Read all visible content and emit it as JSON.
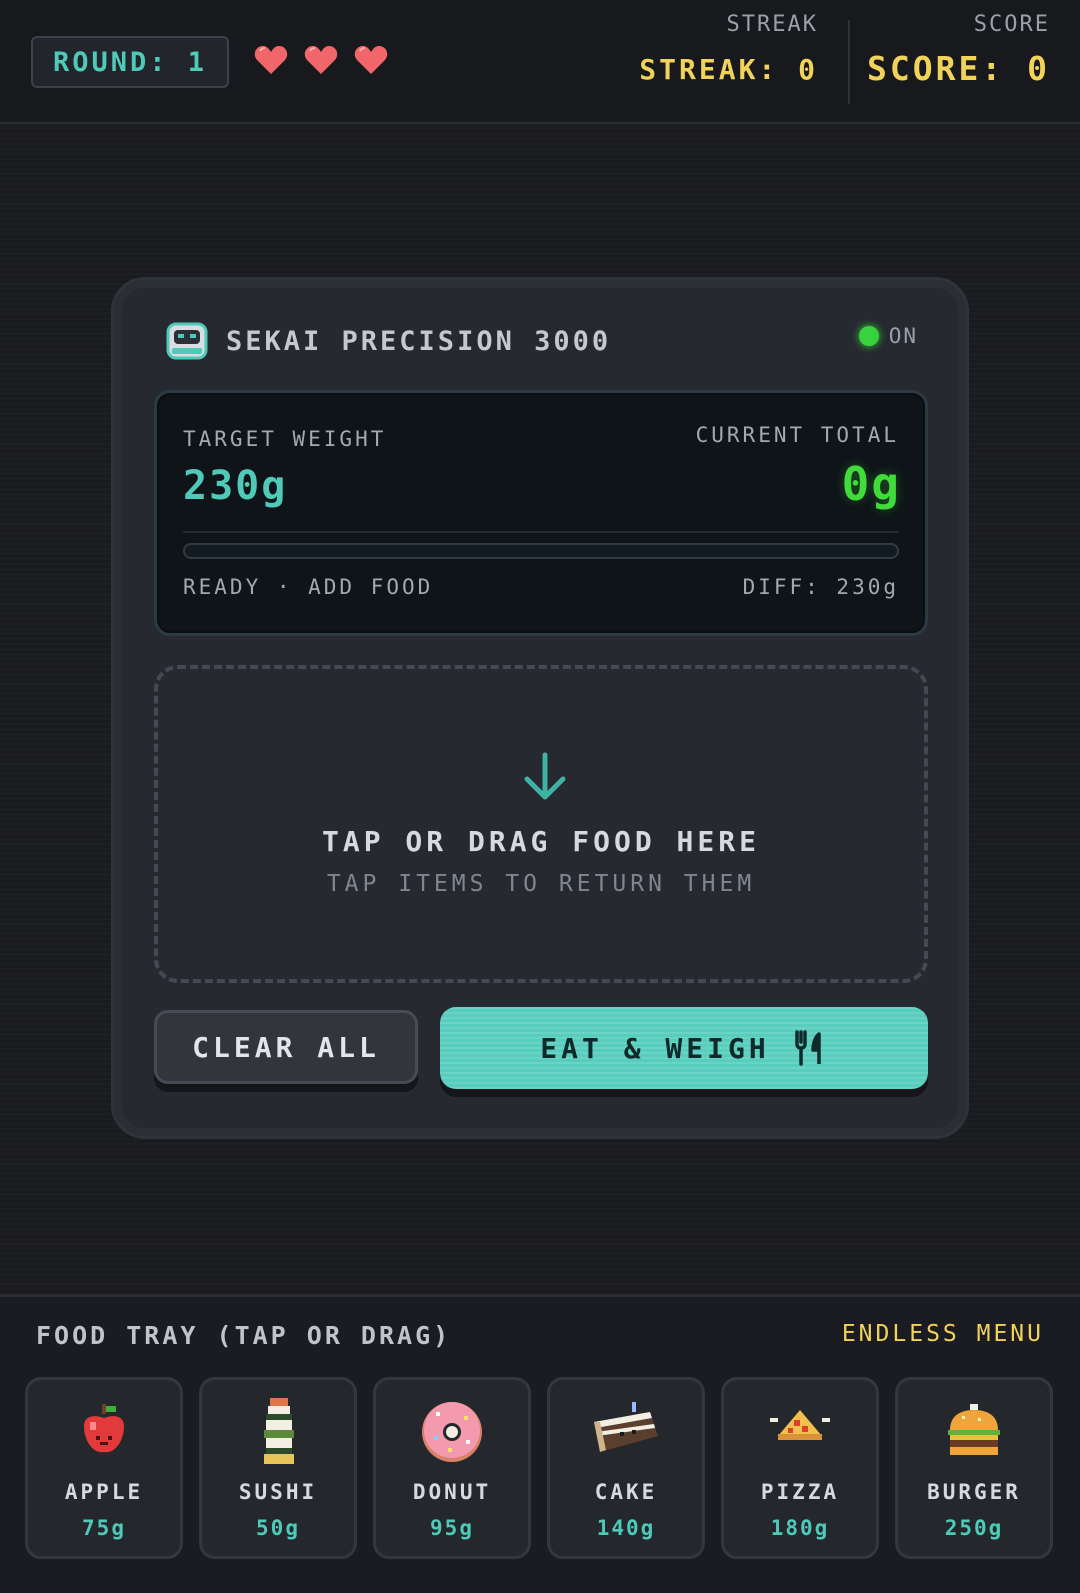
{
  "header": {
    "round_label": "ROUND: 1",
    "lives": 3,
    "streak_caption": "STREAK",
    "streak_value": "STREAK: 0",
    "score_caption": "SCORE",
    "score_value": "SCORE: 0"
  },
  "machine": {
    "title": "SEKAI PRECISION 3000",
    "power_label": "ON",
    "target_label": "TARGET WEIGHT",
    "target_value": "230g",
    "current_label": "CURRENT TOTAL",
    "current_value": "0g",
    "progress_fraction": 0,
    "status": "READY · ADD FOOD",
    "diff": "DIFF: 230g"
  },
  "dropzone": {
    "title": "TAP OR DRAG FOOD HERE",
    "subtitle": "TAP ITEMS TO RETURN THEM"
  },
  "actions": {
    "clear_label": "CLEAR ALL",
    "eat_label": "EAT & WEIGH"
  },
  "tray": {
    "title": "FOOD TRAY (TAP OR DRAG)",
    "mode": "ENDLESS MENU",
    "items": [
      {
        "name": "APPLE",
        "weight": "75g",
        "icon": "apple-icon"
      },
      {
        "name": "SUSHI",
        "weight": "50g",
        "icon": "sushi-icon"
      },
      {
        "name": "DONUT",
        "weight": "95g",
        "icon": "donut-icon"
      },
      {
        "name": "CAKE",
        "weight": "140g",
        "icon": "cake-icon"
      },
      {
        "name": "PIZZA",
        "weight": "180g",
        "icon": "pizza-icon"
      },
      {
        "name": "BURGER",
        "weight": "250g",
        "icon": "burger-icon"
      }
    ]
  },
  "colors": {
    "accent": "#4fc9b8",
    "gold": "#f1d35a",
    "led_green": "#37d33e",
    "heart": "#f0666a"
  }
}
